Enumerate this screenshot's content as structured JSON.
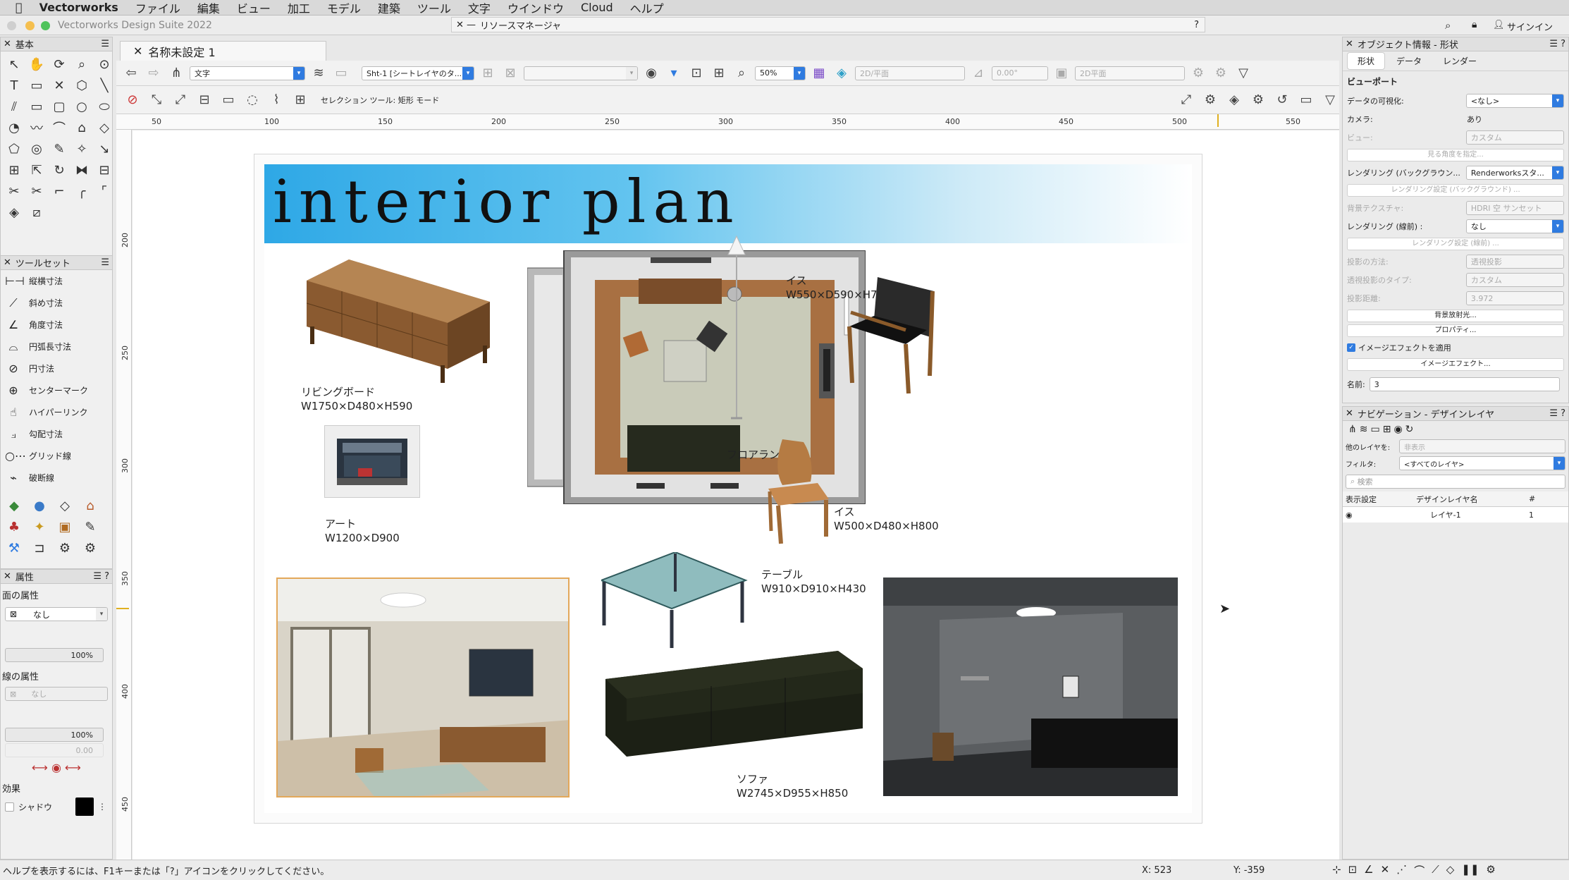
{
  "menubar": {
    "app": "Vectorworks",
    "items": [
      "ファイル",
      "編集",
      "ビュー",
      "加工",
      "モデル",
      "建築",
      "ツール",
      "文字",
      "ウインドウ",
      "Cloud",
      "ヘルプ"
    ]
  },
  "window": {
    "title": "Vectorworks Design Suite 2022",
    "resource_manager": "リソースマネージャ",
    "help_q": "?",
    "signin": "サインイン"
  },
  "document_tab": {
    "label": "名称未設定 1"
  },
  "view_bar": {
    "class_select": "文字",
    "sheet_select": "Sht-1 [シートレイヤのタ...",
    "zoom": "50%",
    "view_select": "2D/平面",
    "angle": "0.00°",
    "render_select": "2D平面"
  },
  "tool_bar": {
    "mode_text": "セレクション ツール: 矩形 モード"
  },
  "ruler": {
    "h_ticks": [
      "50",
      "100",
      "150",
      "200",
      "250",
      "300",
      "350",
      "400",
      "450",
      "500",
      "550"
    ],
    "v_ticks": [
      "200",
      "250",
      "300",
      "350",
      "400",
      "450"
    ]
  },
  "palettes": {
    "basic": {
      "title": "基本"
    },
    "toolset": {
      "title": "ツールセット",
      "items": [
        {
          "label": "縦横寸法",
          "icon": "linear-dimension-icon"
        },
        {
          "label": "斜め寸法",
          "icon": "diagonal-dimension-icon"
        },
        {
          "label": "角度寸法",
          "icon": "angle-dimension-icon"
        },
        {
          "label": "円弧長寸法",
          "icon": "arc-length-icon"
        },
        {
          "label": "円寸法",
          "icon": "circle-dimension-icon"
        },
        {
          "label": "センターマーク",
          "icon": "center-mark-icon"
        },
        {
          "label": "ハイパーリンク",
          "icon": "hyperlink-icon"
        },
        {
          "label": "勾配寸法",
          "icon": "slope-dimension-icon"
        },
        {
          "label": "グリッド線",
          "icon": "grid-line-icon"
        },
        {
          "label": "破断線",
          "icon": "break-line-icon"
        }
      ]
    },
    "attributes": {
      "title": "属性",
      "fill_label": "面の属性",
      "fill_value": "なし",
      "fill_opacity": "100%",
      "line_label": "線の属性",
      "line_value": "なし",
      "line_opacity": "100%",
      "line_weight": "0.00",
      "effects_label": "効果",
      "shadow_label": "シャドウ"
    }
  },
  "sheet": {
    "banner_title": "interior plan",
    "items": {
      "living_board": {
        "name": "リビングボード",
        "dims": "W1750×D480×H590"
      },
      "chair1": {
        "name": "イス",
        "dims": "W550×D590×H780"
      },
      "floor_lamp": {
        "name": "フロアランプ"
      },
      "art": {
        "name": "アート",
        "dims": "W1200×D900"
      },
      "chair2": {
        "name": "イス",
        "dims": "W500×D480×H800"
      },
      "table": {
        "name": "テーブル",
        "dims": "W910×D910×H430"
      },
      "sofa": {
        "name": "ソファ",
        "dims": "W2745×D955×H850"
      }
    }
  },
  "obj_info": {
    "title": "オブジェクト情報 - 形状",
    "tabs": [
      "形状",
      "データ",
      "レンダー"
    ],
    "section": "ビューポート",
    "rows": [
      {
        "k": "データの可視化:",
        "v": "<なし>"
      },
      {
        "k": "カメラ:",
        "v": "あり"
      },
      {
        "k": "ビュー:",
        "v": "カスタム"
      },
      {
        "k": "",
        "v": "見る角度を指定..."
      },
      {
        "k": "レンダリング (バックグラウン...",
        "v": "Renderworksスタ..."
      },
      {
        "k": "",
        "v": "レンダリング設定 (バックグラウンド) ..."
      },
      {
        "k": "背景テクスチャ:",
        "v": "HDRI 空 サンセット"
      },
      {
        "k": "レンダリング (線前) :",
        "v": "なし"
      },
      {
        "k": "",
        "v": "レンダリング設定 (線前) ..."
      },
      {
        "k": "投影の方法:",
        "v": "透視投影"
      },
      {
        "k": "透視投影のタイプ:",
        "v": "カスタム"
      },
      {
        "k": "投影距離:",
        "v": "3.972"
      }
    ],
    "buttons": [
      "背景放射光...",
      "プロパティ..."
    ],
    "image_effect_check": "イメージエフェクトを適用",
    "image_effect_button": "イメージエフェクト...",
    "name_label": "名前:",
    "name_value": "3"
  },
  "navigation": {
    "title": "ナビゲーション - デザインレイヤ",
    "other_layers_label": "他のレイヤを:",
    "other_layers_value": "非表示",
    "filter_label": "フィルタ:",
    "filter_value": "<すべてのレイヤ>",
    "search_placeholder": "検索",
    "col_visibility": "表示設定",
    "col_name": "デザインレイヤ名",
    "col_num": "#",
    "layer_name": "レイヤ-1",
    "layer_num": "1"
  },
  "status": {
    "help": "ヘルプを表示するには、F1キーまたは「?」アイコンをクリックしてください。",
    "x": "X: 523",
    "y": "Y: -359"
  },
  "colors": {
    "accent": "#2f7be0",
    "banner": "#48b6e8"
  }
}
